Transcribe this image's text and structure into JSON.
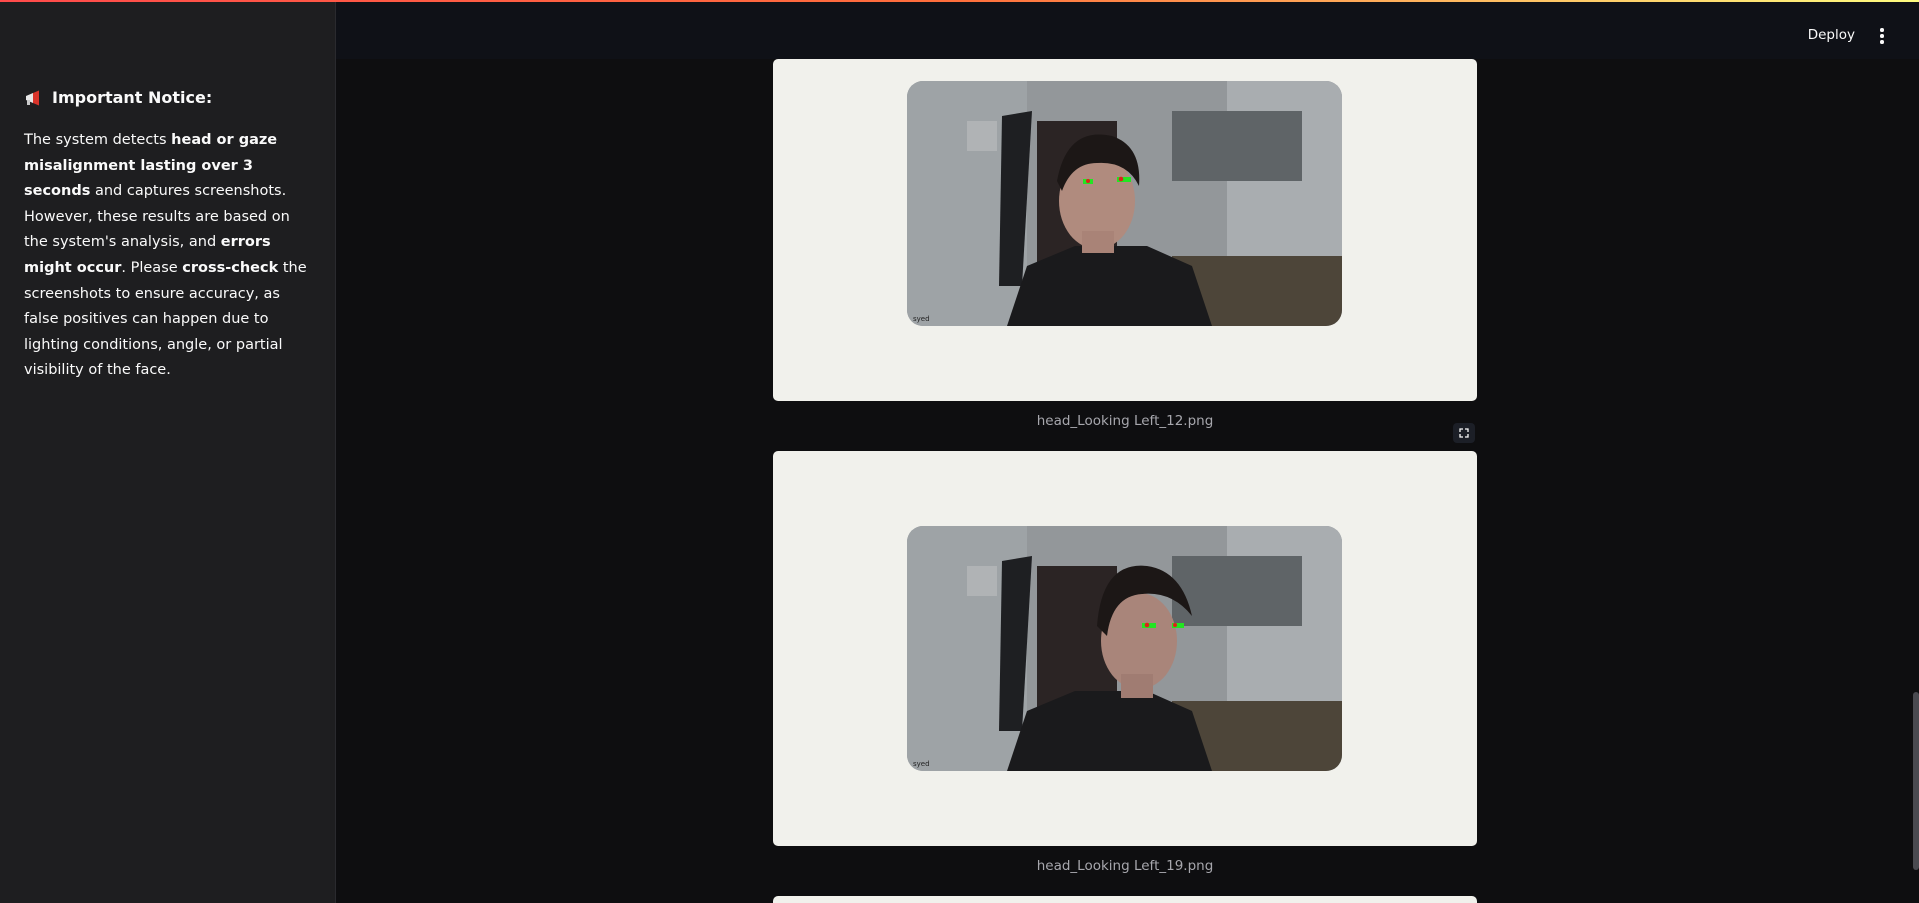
{
  "sidebar": {
    "notice_title": "Important Notice:",
    "notice_icon": "megaphone-icon",
    "notice_parts": [
      {
        "text": "The system detects ",
        "bold": false
      },
      {
        "text": "head or gaze misalignment lasting over 3 seconds",
        "bold": true
      },
      {
        "text": " and captures screenshots. However, these results are based on the system's analysis, and ",
        "bold": false
      },
      {
        "text": "errors might occur",
        "bold": true
      },
      {
        "text": ". Please ",
        "bold": false
      },
      {
        "text": "cross-check",
        "bold": true
      },
      {
        "text": " the screenshots to ensure accuracy, as false positives can happen due to lighting conditions, angle, or partial visibility of the face.",
        "bold": false
      }
    ]
  },
  "header": {
    "deploy_label": "Deploy",
    "menu_icon": "kebab-menu-icon"
  },
  "images": [
    {
      "caption": "head_Looking Left_12.png",
      "frame_label": "syed"
    },
    {
      "caption": "head_Looking Left_19.png",
      "frame_label": "syed"
    }
  ],
  "colors": {
    "accent_start": "#ff4b4b",
    "accent_end": "#fffd80",
    "sidebar_bg": "#1e1e20",
    "main_bg": "#0e0e10",
    "card_bg": "#f1f1ec",
    "landmark_green": "#22e622",
    "landmark_red": "#e0201a"
  }
}
